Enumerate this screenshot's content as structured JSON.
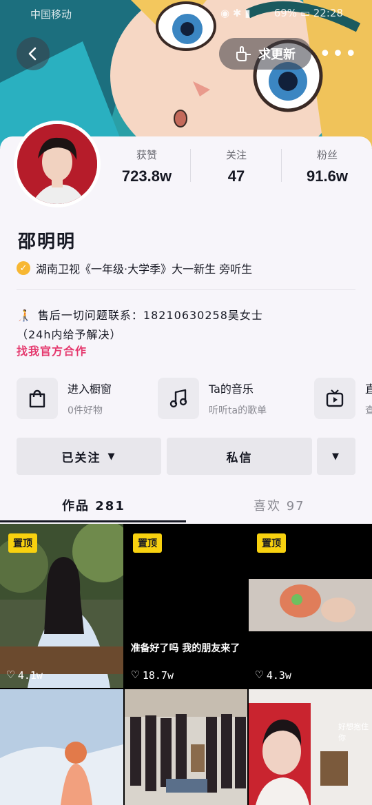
{
  "status_bar": {
    "carrier": "中国移动",
    "battery": "69%",
    "time": "22:28"
  },
  "header": {
    "update_label": "求更新"
  },
  "stats": [
    {
      "label": "获赞",
      "value": "723.8w"
    },
    {
      "label": "关注",
      "value": "47"
    },
    {
      "label": "粉丝",
      "value": "91.6w"
    }
  ],
  "profile": {
    "name": "邵明明",
    "verification": "湖南卫视《一年级·大学季》大一新生 旁听生",
    "bio_line1": "售后一切问题联系：18210630258吴女士",
    "bio_line2": "（24h内给予解决）",
    "business_link": "找我官方合作"
  },
  "features": [
    {
      "title": "进入橱窗",
      "subtitle": "0件好物",
      "icon": "shopping-bag-icon"
    },
    {
      "title": "Ta的音乐",
      "subtitle": "听听ta的歌单",
      "icon": "music-note-icon"
    },
    {
      "title": "直",
      "subtitle": "查",
      "icon": "tv-icon"
    }
  ],
  "actions": {
    "follow": "已关注",
    "message": "私信"
  },
  "tabs": {
    "works": "作品 281",
    "likes": "喜欢 97"
  },
  "grid": [
    {
      "pinned": "置顶",
      "likes": "4.1w",
      "caption": ""
    },
    {
      "pinned": "置顶",
      "likes": "18.7w",
      "caption": "准备好了吗 我的朋友来了"
    },
    {
      "pinned": "置顶",
      "likes": "4.3w",
      "caption": ""
    },
    {
      "pinned": "",
      "likes": "",
      "caption": ""
    },
    {
      "pinned": "",
      "likes": "",
      "caption": ""
    },
    {
      "pinned": "",
      "likes": "",
      "caption": "",
      "overlay_text": "好想抱住你"
    }
  ],
  "colors": {
    "accent_pink": "#e5396e",
    "pin_yellow": "#f8d10f",
    "verify_gold": "#f7b733",
    "card_bg": "#f7f5fa"
  }
}
